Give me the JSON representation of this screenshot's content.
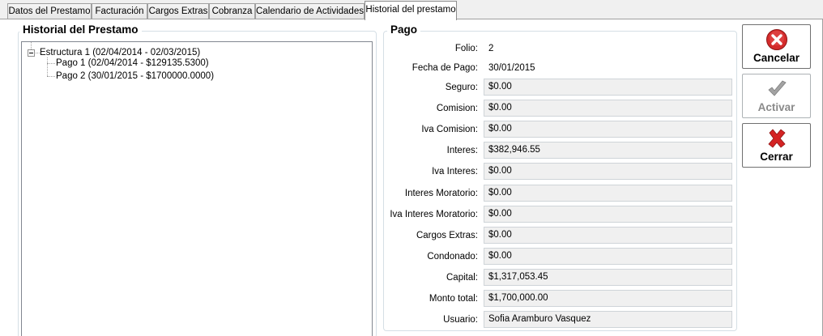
{
  "tabs": [
    {
      "label": "Datos del Prestamo",
      "active": false
    },
    {
      "label": "Facturación",
      "active": false
    },
    {
      "label": "Cargos Extras",
      "active": false
    },
    {
      "label": "Cobranza",
      "active": false
    },
    {
      "label": "Calendario de Actividades",
      "active": false
    },
    {
      "label": "Historial del prestamo",
      "active": true
    }
  ],
  "history": {
    "title": "Historial del Prestamo",
    "tree": {
      "root": "Estructura 1 (02/04/2014 - 02/03/2015)",
      "children": [
        "Pago 1 (02/04/2014 - $129135.5300)",
        "Pago 2 (30/01/2015 - $1700000.0000)"
      ]
    }
  },
  "pago": {
    "title": "Pago",
    "folio_label": "Folio:",
    "folio_value": "2",
    "fecha_label": "Fecha de Pago:",
    "fecha_value": "30/01/2015",
    "fields": [
      {
        "label": "Seguro:",
        "value": "$0.00"
      },
      {
        "label": "Comision:",
        "value": "$0.00"
      },
      {
        "label": "Iva Comision:",
        "value": "$0.00"
      },
      {
        "label": "Interes:",
        "value": "$382,946.55"
      },
      {
        "label": "Iva Interes:",
        "value": "$0.00"
      },
      {
        "label": "Interes Moratorio:",
        "value": "$0.00"
      },
      {
        "label": "Iva Interes Moratorio:",
        "value": "$0.00"
      },
      {
        "label": "Cargos Extras:",
        "value": "$0.00"
      },
      {
        "label": "Condonado:",
        "value": "$0.00"
      },
      {
        "label": "Capital:",
        "value": "$1,317,053.45"
      },
      {
        "label": "Monto total:",
        "value": "$1,700,000.00"
      },
      {
        "label": "Usuario:",
        "value": "Sofia Aramburo Vasquez"
      }
    ]
  },
  "actions": {
    "cancelar": "Cancelar",
    "activar": "Activar",
    "cerrar": "Cerrar"
  },
  "colors": {
    "cancel_red": "#d42b2b",
    "check_gray": "#9a9a9a",
    "close_red": "#d42323"
  },
  "icons": {
    "cancelar": "cancel-circle-x-icon",
    "activar": "check-mark-icon",
    "cerrar": "red-x-icon",
    "tree_toggle": "tree-collapse-minus-icon"
  }
}
